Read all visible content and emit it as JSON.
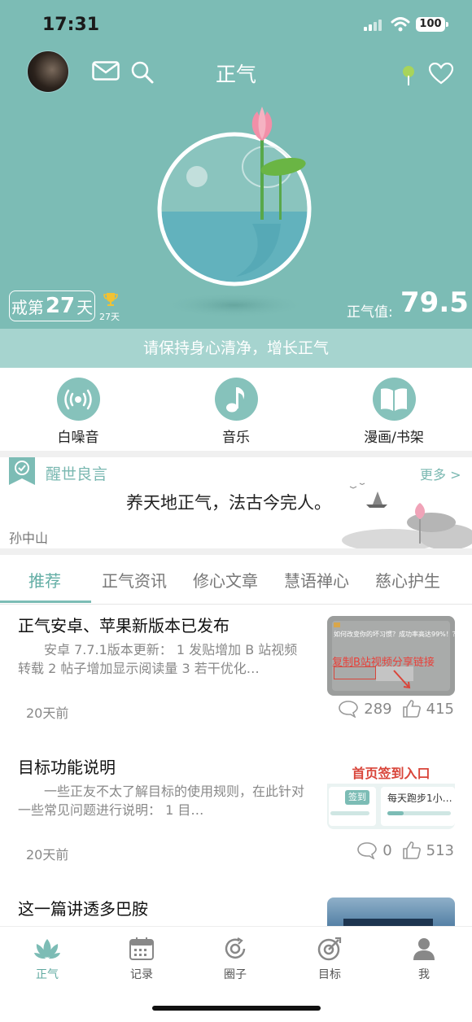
{
  "status_bar": {
    "time": "17:31",
    "battery": "100"
  },
  "header": {
    "title": "正气",
    "days_prefix": "戒第",
    "days_number": "27",
    "days_suffix": "天",
    "trophy_days": "27天",
    "zhengqi_label": "正气值:",
    "zhengqi_value": "79.5",
    "banner": "请保持身心清净，增长正气"
  },
  "tools": [
    {
      "label": "白噪音",
      "icon": "white-noise-icon"
    },
    {
      "label": "音乐",
      "icon": "music-note-icon"
    },
    {
      "label": "漫画/书架",
      "icon": "book-icon"
    }
  ],
  "quote": {
    "title": "醒世良言",
    "more": "更多 >",
    "text": "养天地正气，法古今完人。",
    "author": "孙中山"
  },
  "tabs": [
    "推荐",
    "正气资讯",
    "修心文章",
    "慧语禅心",
    "慈心护生"
  ],
  "articles": [
    {
      "title": "正气安卓、苹果新版本已发布",
      "summary": "安卓 7.7.1版本更新： 1 发贴增加 B 站视频转载 2 帖子增加显示阅读量 3 若干优化…",
      "ago": "20天前",
      "comments": "289",
      "likes": "415",
      "thumb_top": "如何改变你的坏习惯？成功率高达99%！？",
      "thumb_overlay": "复制B站视频分享链接"
    },
    {
      "title": "目标功能说明",
      "summary": "一些正友不太了解目标的使用规则，在此针对一些常见问题进行说明：       1 目…",
      "ago": "20天前",
      "comments": "0",
      "likes": "513",
      "thumb_heading": "首页签到入口",
      "thumb_sign": "签到",
      "thumb_goal": "每天跑步1小…"
    },
    {
      "title": "这一篇讲透多巴胺"
    }
  ],
  "nav": [
    {
      "label": "正气",
      "icon": "lotus-icon"
    },
    {
      "label": "记录",
      "icon": "calendar-icon"
    },
    {
      "label": "圈子",
      "icon": "circle-refresh-icon"
    },
    {
      "label": "目标",
      "icon": "target-icon"
    },
    {
      "label": "我",
      "icon": "person-icon"
    }
  ],
  "colors": {
    "accent": "#7cbcb5",
    "tab_active": "#63aea5",
    "banner": "#a6d4cf",
    "red": "#d9453a"
  }
}
